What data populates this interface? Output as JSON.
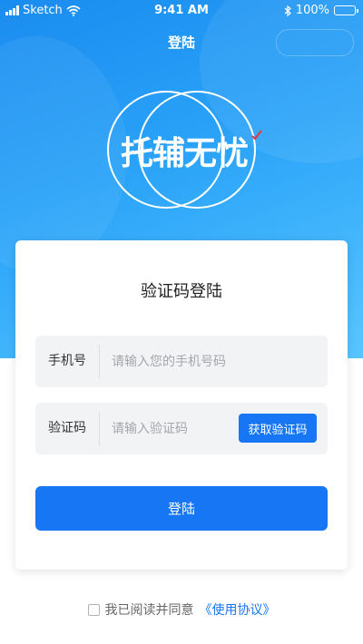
{
  "status_bar": {
    "carrier": "Sketch",
    "time": "9:41 AM",
    "battery_percent": "100%",
    "icons": [
      "signal-icon",
      "wifi-icon",
      "bluetooth-icon",
      "battery-icon"
    ]
  },
  "nav": {
    "title": "登陆"
  },
  "logo": {
    "text": "托辅无忧"
  },
  "card": {
    "title": "验证码登陆",
    "phone": {
      "label": "手机号",
      "placeholder": "请输入您的手机号码",
      "value": ""
    },
    "code": {
      "label": "验证码",
      "placeholder": "请输入验证码",
      "value": "",
      "button_label": "获取验证码"
    },
    "login_button": "登陆"
  },
  "agreement": {
    "checked": false,
    "text": "我已阅读并同意",
    "link_text": "《使用协议》"
  },
  "colors": {
    "primary": "#1676f3",
    "hero_top": "#1a8cf0",
    "hero_bottom": "#58c6ff",
    "field_bg": "#f2f3f5",
    "check_mark": "#e53935"
  }
}
